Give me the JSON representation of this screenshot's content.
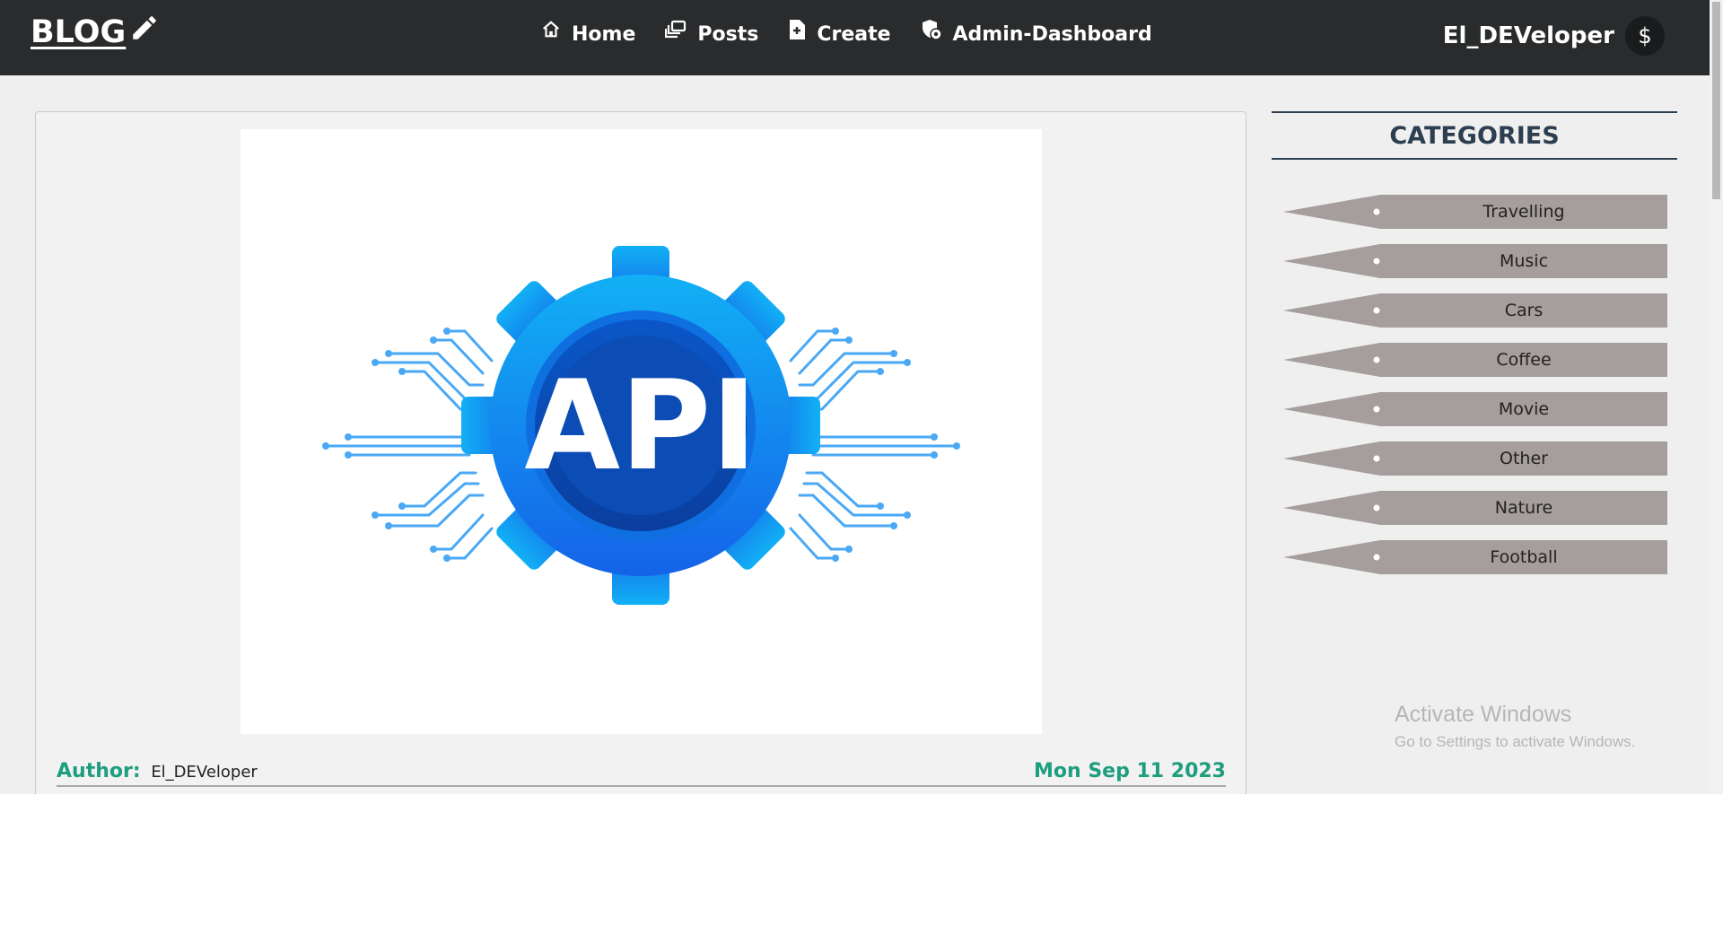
{
  "navbar": {
    "brand": "BLOG",
    "links": [
      {
        "label": "Home",
        "icon": "home-icon"
      },
      {
        "label": "Posts",
        "icon": "posts-icon"
      },
      {
        "label": "Create",
        "icon": "create-file-icon"
      },
      {
        "label": "Admin-Dashboard",
        "icon": "admin-shield-icon"
      }
    ],
    "user": "El_DEVeloper",
    "avatar_glyph": "$"
  },
  "post": {
    "image_text": "API",
    "author_label": "Author:",
    "author_name": "El_DEVeloper",
    "date": "Mon Sep 11 2023"
  },
  "categories": {
    "title": "CATEGORIES",
    "items": [
      "Travelling",
      "Music",
      "Cars",
      "Coffee",
      "Movie",
      "Other",
      "Nature",
      "Football"
    ]
  },
  "watermark": {
    "title": "Activate Windows",
    "subtitle": "Go to Settings to activate Windows."
  },
  "colors": {
    "navbar_bg": "#292b2c",
    "accent_green": "#1e9e7e",
    "category_tag": "#a69d9d",
    "api_blue": "#1a8ef0"
  }
}
